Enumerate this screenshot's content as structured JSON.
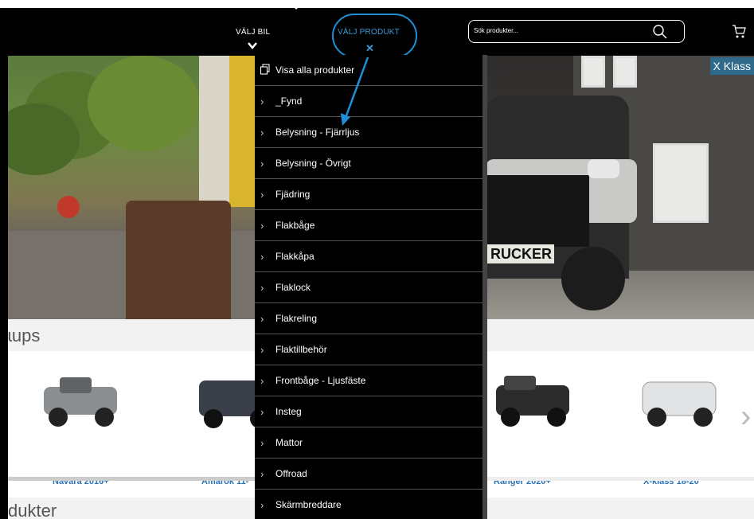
{
  "header": {
    "nav_valj_bil": "VÄLJ BIL",
    "nav_valj_produkt": "VÄLJ PRODUKT",
    "search_placeholder": "Sök produkter...",
    "accent_color": "#3a9bd5"
  },
  "hero": {
    "badge": "X Klass",
    "plate_text": "RUCKER"
  },
  "dropdown": {
    "items": [
      {
        "label": "Visa alla produkter",
        "icon": "copy-icon"
      },
      {
        "label": "_Fynd",
        "icon": "chevron-right-icon"
      },
      {
        "label": "Belysning - Fjärrljus",
        "icon": "chevron-right-icon"
      },
      {
        "label": "Belysning - Övrigt",
        "icon": "chevron-right-icon"
      },
      {
        "label": "Fjädring",
        "icon": "chevron-right-icon"
      },
      {
        "label": "Flakbåge",
        "icon": "chevron-right-icon"
      },
      {
        "label": "Flakkåpa",
        "icon": "chevron-right-icon"
      },
      {
        "label": "Flaklock",
        "icon": "chevron-right-icon"
      },
      {
        "label": "Flakreling",
        "icon": "chevron-right-icon"
      },
      {
        "label": "Flaktillbehör",
        "icon": "chevron-right-icon"
      },
      {
        "label": "Frontbåge - Ljusfäste",
        "icon": "chevron-right-icon"
      },
      {
        "label": "Insteg",
        "icon": "chevron-right-icon"
      },
      {
        "label": "Mattor",
        "icon": "chevron-right-icon"
      },
      {
        "label": "Offroad",
        "icon": "chevron-right-icon"
      },
      {
        "label": "Skärmbreddare",
        "icon": "chevron-right-icon"
      }
    ]
  },
  "sections": {
    "pickups_title": "ɩups",
    "products_title": "dukter"
  },
  "cars": [
    {
      "name": "Navara 2016+"
    },
    {
      "name": "Amarok 11-"
    },
    {
      "name": "Ranger 2020+"
    },
    {
      "name": "X-klass 18-20"
    }
  ]
}
